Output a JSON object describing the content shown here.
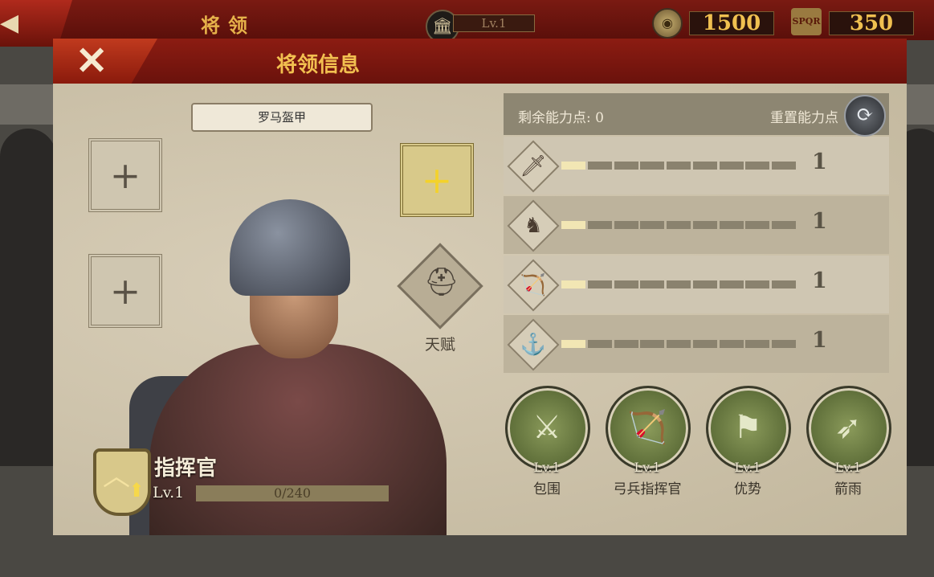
{
  "hud": {
    "title": "将领",
    "level": "Lv.1",
    "coins": "1500",
    "tokens": "350"
  },
  "panel": {
    "title": "将领信息",
    "armor_label": "罗马盔甲",
    "talent_label": "天赋"
  },
  "general": {
    "rank_name": "指挥官",
    "level": "Lv.1",
    "exp_text": "0/240",
    "exp_fraction": 0
  },
  "ability": {
    "remaining_label": "剩余能力点: 0",
    "reset_label": "重置能力点",
    "stats": [
      {
        "icon": "sword-icon",
        "glyph": "🗡",
        "value": "1",
        "filled": 1,
        "total": 9
      },
      {
        "icon": "horse-icon",
        "glyph": "♞",
        "value": "1",
        "filled": 1,
        "total": 9
      },
      {
        "icon": "bow-icon",
        "glyph": "🏹",
        "value": "1",
        "filled": 1,
        "total": 9
      },
      {
        "icon": "anchor-icon",
        "glyph": "⚓",
        "value": "1",
        "filled": 1,
        "total": 9
      }
    ]
  },
  "skills": [
    {
      "name": "包围",
      "level": "Lv.1",
      "icon": "encircle-icon",
      "glyph": "⚔"
    },
    {
      "name": "弓兵指挥官",
      "level": "Lv.1",
      "icon": "bow-commander-icon",
      "glyph": "🏹"
    },
    {
      "name": "优势",
      "level": "Lv.1",
      "icon": "advantage-icon",
      "glyph": "⚑"
    },
    {
      "name": "箭雨",
      "level": "Lv.1",
      "icon": "arrow-rain-icon",
      "glyph": "➶"
    }
  ],
  "colors": {
    "header_red": "#8c1c12",
    "gold_text": "#f2c050",
    "panel_bg": "#cdc3ad",
    "skill_green": "#6a7a3a"
  }
}
